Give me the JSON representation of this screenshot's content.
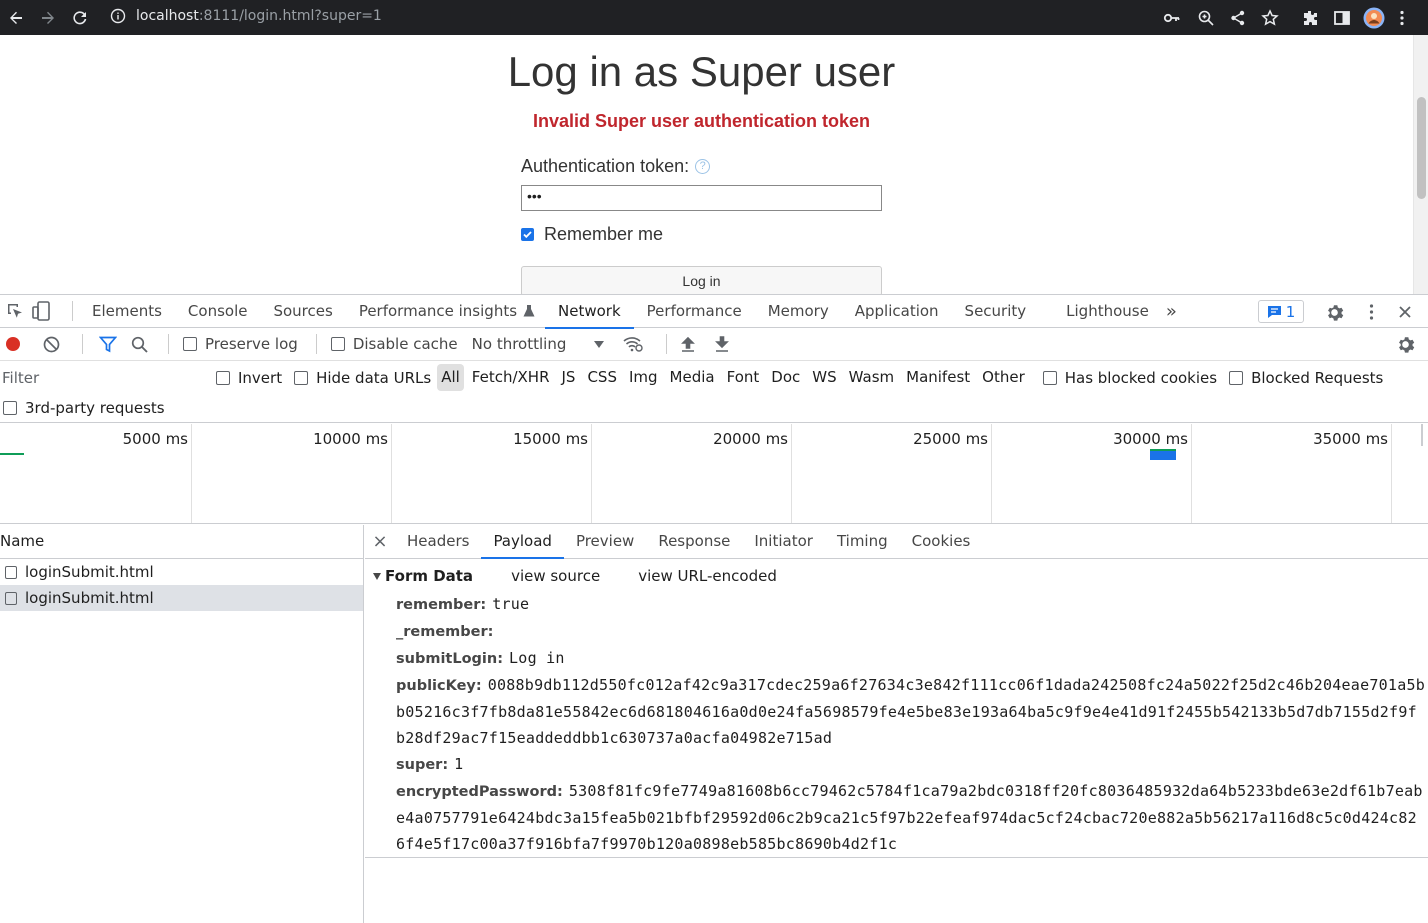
{
  "browser": {
    "url_host": "localhost",
    "url_rest": ":8111/login.html?super=1"
  },
  "page": {
    "title": "Log in as Super user",
    "error": "Invalid Super user authentication token",
    "auth_label": "Authentication token:",
    "help_glyph": "?",
    "token_value": "•••",
    "remember_label": "Remember me",
    "remember_checked": true,
    "login_button": "Log in"
  },
  "devtools": {
    "tabs": [
      "Elements",
      "Console",
      "Sources",
      "Performance insights",
      "Network",
      "Performance",
      "Memory",
      "Application",
      "Security",
      "Lighthouse"
    ],
    "active_tab": "Network",
    "more_tabs": "»",
    "issues_count": "1",
    "toolbar": {
      "preserve_log": "Preserve log",
      "disable_cache": "Disable cache",
      "throttling": "No throttling"
    },
    "filter": {
      "placeholder": "Filter",
      "invert": "Invert",
      "hide_data_urls": "Hide data URLs",
      "types": [
        "All",
        "Fetch/XHR",
        "JS",
        "CSS",
        "Img",
        "Media",
        "Font",
        "Doc",
        "WS",
        "Wasm",
        "Manifest",
        "Other"
      ],
      "active_type": "All",
      "has_blocked_cookies": "Has blocked cookies",
      "blocked_requests": "Blocked Requests",
      "third_party": "3rd-party requests"
    },
    "overview_ticks": [
      "5000 ms",
      "10000 ms",
      "15000 ms",
      "20000 ms",
      "25000 ms",
      "30000 ms",
      "35000 ms"
    ],
    "requests": {
      "header": "Name",
      "rows": [
        "loginSubmit.html",
        "loginSubmit.html"
      ],
      "selected_index": 1
    },
    "details": {
      "close": "×",
      "tabs": [
        "Headers",
        "Payload",
        "Preview",
        "Response",
        "Initiator",
        "Timing",
        "Cookies"
      ],
      "active_tab": "Payload",
      "form_data_title": "Form Data",
      "view_source": "view source",
      "view_url_encoded": "view URL-encoded",
      "fields": [
        {
          "key": "remember:",
          "value": "true"
        },
        {
          "key": "_remember:",
          "value": ""
        },
        {
          "key": "submitLogin:",
          "value": "Log in"
        },
        {
          "key": "publicKey:",
          "value": "0088b9db112d550fc012af42c9a317cdec259a6f27634c3e842f111cc06f1dada242508fc24a5022f25d2c46b204eae701a5bb05216c3f7fb8da81e55842ec6d681804616a0d0e24fa5698579fe4e5be83e193a64ba5c9f9e4e41d91f2455b542133b5d7db7155d2f9fb28df29ac7f15eaddeddbb1c630737a0acfa04982e715ad"
        },
        {
          "key": "super:",
          "value": "1"
        },
        {
          "key": "encryptedPassword:",
          "value": "5308f81fc9fe7749a81608b6cc79462c5784f1ca79a2bdc0318ff20fc8036485932da64b5233bde63e2df61b7eabe4a0757791e6424bdc3a15fea5b021bfbf29592d06c2b9ca21c5f97b22efeaf974dac5cf24cbac720e882a5b56217a116d8c5c0d424c826f4e5f17c00a37f916bfa7f9970b120a0898eb585bc8690b4d2f1c"
        }
      ]
    }
  },
  "colors": {
    "chrome_bg": "#202124",
    "error_red": "#c0262d",
    "accent_blue": "#1a73e8",
    "record_red": "#d93025"
  }
}
